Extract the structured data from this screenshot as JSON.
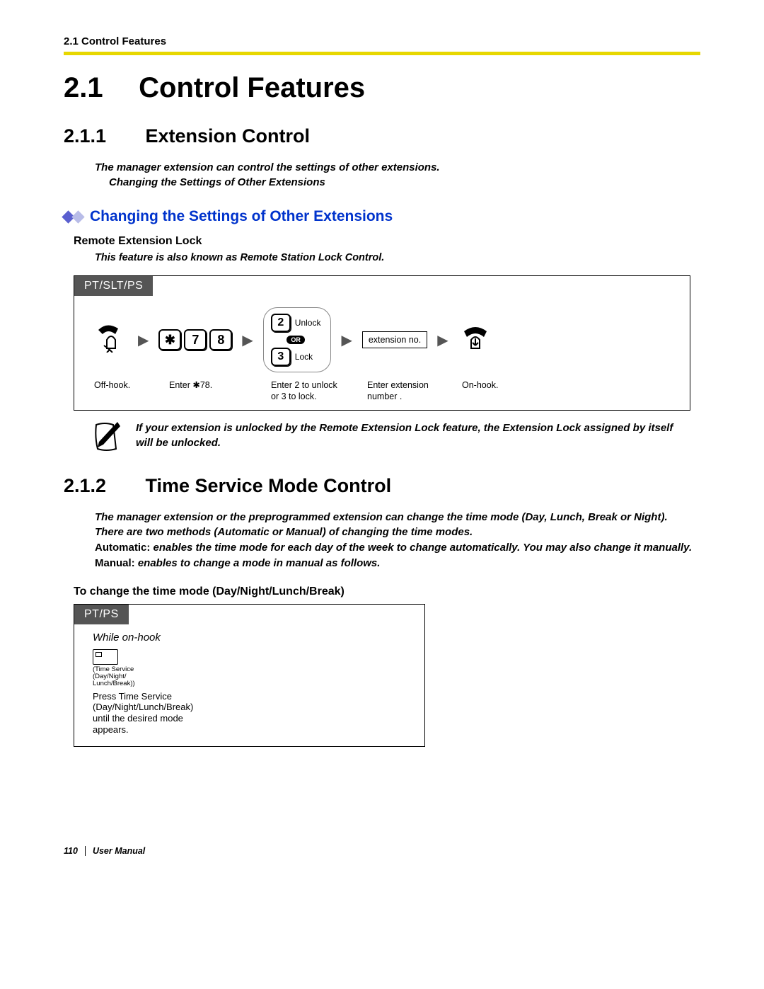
{
  "header": {
    "breadcrumb": "2.1 Control Features"
  },
  "h1": {
    "num": "2.1",
    "title": "Control Features"
  },
  "s211": {
    "num": "2.1.1",
    "title": "Extension Control",
    "intro_l1": "The manager extension can control the settings of other extensions.",
    "intro_l2": "Changing the Settings of Other Extensions",
    "blue_heading": "Changing the Settings of Other Extensions",
    "sub_bold": "Remote Extension Lock",
    "sub_italic": "This feature is also known as Remote Station Lock Control.",
    "proc_tab": "PT/SLT/PS",
    "keys": {
      "star": "✱",
      "k7": "7",
      "k8": "8"
    },
    "opt_unlock_key": "2",
    "opt_unlock_lbl": "Unlock",
    "opt_or": "OR",
    "opt_lock_key": "3",
    "opt_lock_lbl": "Lock",
    "ext_box": "extension no.",
    "cap1": "Off-hook.",
    "cap2": "Enter ✱78.",
    "cap3a": "Enter 2 to unlock",
    "cap3b": "or 3 to lock.",
    "cap4a": "Enter extension",
    "cap4b": "number .",
    "cap5": "On-hook.",
    "note": "If your extension is unlocked by the Remote Extension Lock feature, the Extension Lock assigned by itself will be unlocked."
  },
  "s212": {
    "num": "2.1.2",
    "title": "Time Service Mode Control",
    "p1": "The manager extension or the preprogrammed extension can change the time mode (Day, Lunch, Break or Night).",
    "p2": "There are two methods (Automatic or Manual) of changing the time modes.",
    "p3_label": "Automatic:",
    "p3_rest": " enables the time mode for each day of the week to change automatically. You may also change it manually.",
    "p4_label": "Manual:",
    "p4_rest": " enables to change a mode in manual as follows.",
    "proc_heading": "To change the time mode (Day/Night/Lunch/Break)",
    "proc_tab": "PT/PS",
    "while": "While on-hook",
    "btn_l1": "(Time Service",
    "btn_l2": "(Day/Night/",
    "btn_l3": "Lunch/Break))",
    "press_l1": "Press Time Service",
    "press_l2": "(Day/Night/Lunch/Break)",
    "press_l3": "until the desired mode",
    "press_l4": "appears."
  },
  "footer": {
    "page": "110",
    "label": "User Manual"
  }
}
